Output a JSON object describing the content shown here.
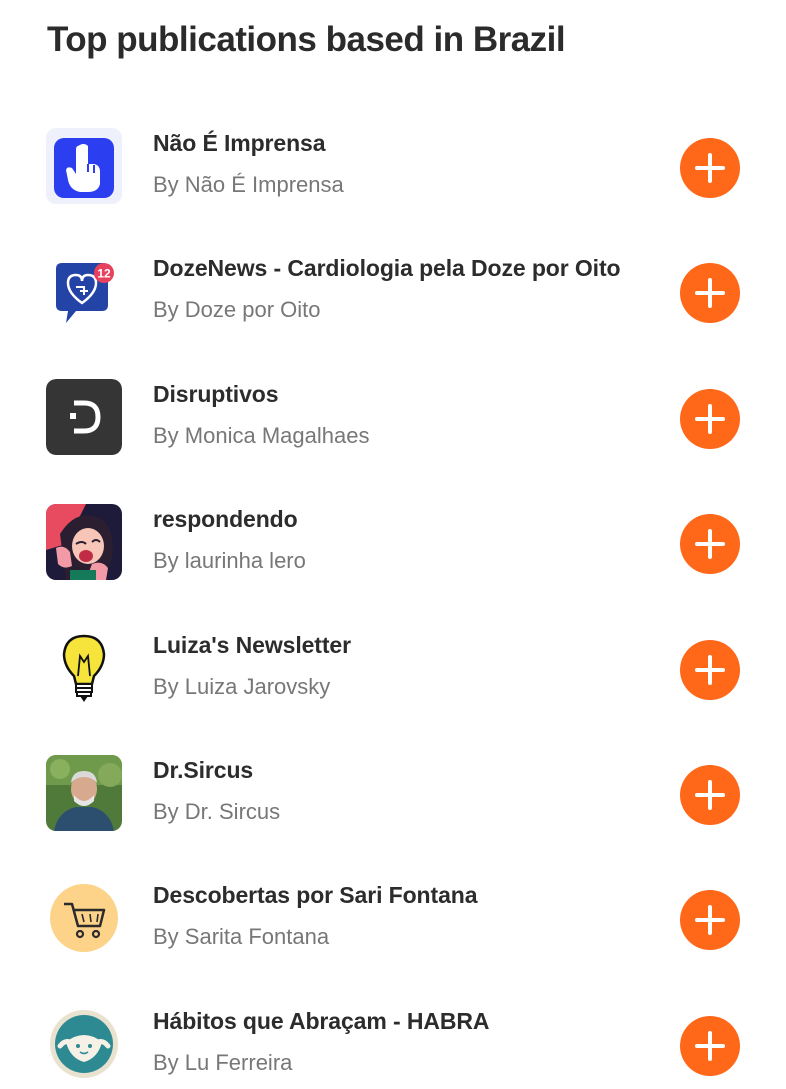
{
  "page": {
    "title": "Top publications based in Brazil"
  },
  "colors": {
    "accent": "#ff6719",
    "title_text": "#2b2b2b",
    "secondary_text": "#777777"
  },
  "publications": [
    {
      "name": "Não É Imprensa",
      "author": "By Não É Imprensa",
      "logo_icon": "hand-pointing-up-icon",
      "action_icon": "plus-icon"
    },
    {
      "name": "DozeNews - Cardiologia pela Doze por Oito",
      "author": "By Doze por Oito",
      "logo_icon": "chat-bubble-heart-icon",
      "logo_badge": "12",
      "action_icon": "plus-icon"
    },
    {
      "name": "Disruptivos",
      "author": "By Monica Magalhaes",
      "logo_icon": "d-letter-icon",
      "action_icon": "plus-icon"
    },
    {
      "name": "respondendo",
      "author": "By laurinha lero",
      "logo_icon": "shouting-woman-illustration",
      "action_icon": "plus-icon"
    },
    {
      "name": "Luiza's Newsletter",
      "author": "By Luiza Jarovsky",
      "logo_icon": "lightbulb-icon",
      "action_icon": "plus-icon"
    },
    {
      "name": "Dr.Sircus",
      "author": "By Dr. Sircus",
      "logo_icon": "author-photo",
      "action_icon": "plus-icon"
    },
    {
      "name": "Descobertas por Sari Fontana",
      "author": "By Sarita Fontana",
      "logo_icon": "shopping-cart-icon",
      "action_icon": "plus-icon"
    },
    {
      "name": "Hábitos que Abraçam - HABRA",
      "author": "By Lu Ferreira",
      "logo_icon": "hug-character-icon",
      "action_icon": "plus-icon"
    }
  ]
}
